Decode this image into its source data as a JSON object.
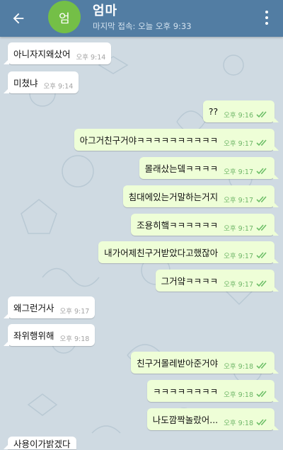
{
  "header": {
    "avatar_initial": "엄",
    "name": "엄마",
    "status": "마지막 접속: 오늘 오후 9:33"
  },
  "messages": [
    {
      "dir": "in",
      "text": "아니자지왜샀어",
      "time": "오후 9:14"
    },
    {
      "dir": "in",
      "text": "미쳤냐",
      "time": "오후 9:14"
    },
    {
      "dir": "out",
      "text": "??",
      "time": "오후 9:16"
    },
    {
      "dir": "out",
      "text": "아그거친구거야ㅋㅋㅋㅋㅋㅋㅋㅋㅋㅋ",
      "time": "오후 9:17"
    },
    {
      "dir": "out",
      "text": "몰래샀는뎈ㅋㅋㅋㅋ",
      "time": "오후 9:17"
    },
    {
      "dir": "out",
      "text": "침대에있는거말하는거지",
      "time": "오후 9:17"
    },
    {
      "dir": "out",
      "text": "조용히햌ㅋㅋㅋㅋㅋㅋ",
      "time": "오후 9:17"
    },
    {
      "dir": "out",
      "text": "내가어제친구거받았다고했잖아",
      "time": "오후 9:17"
    },
    {
      "dir": "out",
      "text": "그거얔ㅋㅋㅋㅋ",
      "time": "오후 9:17"
    },
    {
      "dir": "in",
      "text": "왜그런거사",
      "time": "오후 9:17"
    },
    {
      "dir": "in",
      "text": "좌위행위해",
      "time": "오후 9:18"
    },
    {
      "dir": "out",
      "text": "친구거몰레받아준거야",
      "time": "오후 9:18"
    },
    {
      "dir": "out",
      "text": "ㅋㅋㅋㅋㅋㅋㅋㅋ",
      "time": "오후 9:18"
    },
    {
      "dir": "out",
      "text": "나도깜짝놀랐어...",
      "time": "오후 9:18"
    },
    {
      "dir": "in",
      "text": "사용이가밝겠다",
      "time": ""
    }
  ],
  "colors": {
    "header": "#527da3",
    "wallpaper": "#cfdae2",
    "incoming_bubble": "#ffffff",
    "outgoing_bubble": "#eefed7",
    "read_ticks": "#6dbf67"
  },
  "icons": {
    "back": "arrow-left-icon",
    "menu": "more-vertical-icon",
    "read": "double-check-icon"
  }
}
